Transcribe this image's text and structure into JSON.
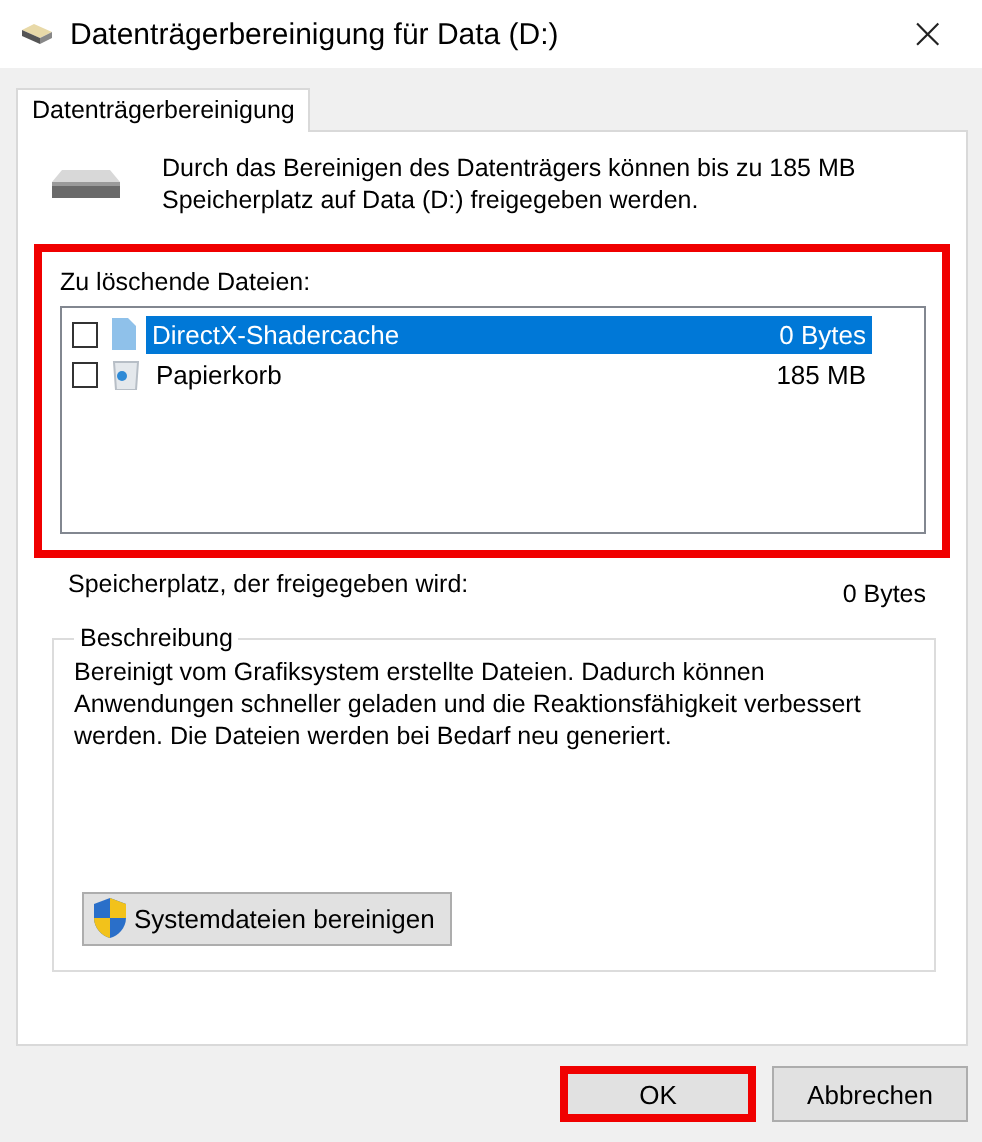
{
  "window": {
    "title": "Datenträgerbereinigung für Data (D:)",
    "close": "×"
  },
  "tabs": [
    {
      "label": "Datenträgerbereinigung",
      "selected": true
    }
  ],
  "summary": "Durch das Bereinigen des Datenträgers können bis zu 185 MB Speicherplatz auf Data (D:) freigegeben werden.",
  "files": {
    "label": "Zu löschende Dateien:",
    "highlighted": true,
    "items": [
      {
        "kind": "file",
        "name": "DirectX-Shadercache",
        "size": "0 Bytes",
        "checked": false,
        "selected": true
      },
      {
        "kind": "recycle",
        "name": "Papierkorb",
        "size": "185 MB",
        "checked": false,
        "selected": false
      }
    ]
  },
  "space": {
    "label": "Speicherplatz, der freigegeben wird:",
    "value": "0 Bytes"
  },
  "description": {
    "title": "Beschreibung",
    "text": "Bereinigt vom Grafiksystem erstellte Dateien. Dadurch können Anwendungen schneller geladen und die Reaktionsfähigkeit verbessert werden. Die Dateien werden bei Bedarf neu generiert.",
    "button": "Systemdateien bereinigen"
  },
  "buttons": [
    {
      "label": "OK",
      "highlighted": true
    },
    {
      "label": "Abbrechen",
      "highlighted": false
    }
  ]
}
